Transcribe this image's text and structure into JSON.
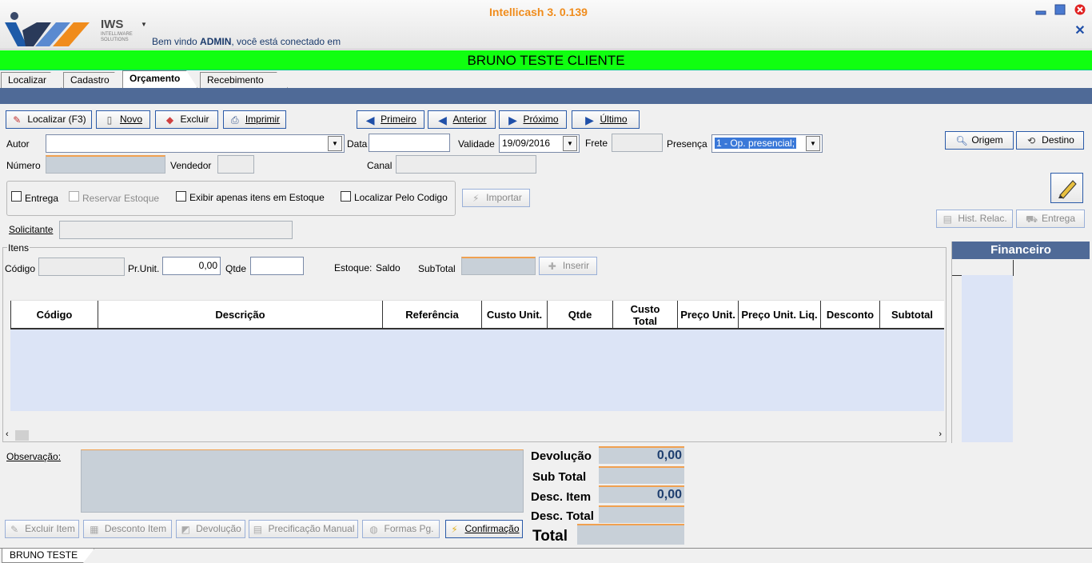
{
  "app": {
    "title": "Intellicash 3. 0.139",
    "brand": "IWS",
    "brand_sub": "INTELLIWARE SOLUTIONS",
    "welcome_prefix": "Bem vindo ",
    "welcome_user": "ADMIN",
    "welcome_suffix": ", você está conectado em"
  },
  "client_name": "BRUNO TESTE CLIENTE",
  "tabs": [
    {
      "label": "Localizar"
    },
    {
      "label": "Cadastro"
    },
    {
      "label": "Orçamento",
      "active": true
    },
    {
      "label": "Recebimento"
    }
  ],
  "toolbar": {
    "localizar": "Localizar (F3)",
    "novo": "Novo",
    "excluir": "Excluir",
    "imprimir": "Imprimir",
    "primeiro": "Primeiro",
    "anterior": "Anterior",
    "proximo": "Próximo",
    "ultimo": "Último",
    "origem": "Origem",
    "destino": "Destino",
    "hist_relac": "Hist. Relac.",
    "entrega": "Entrega"
  },
  "form": {
    "autor_label": "Autor",
    "autor_value": "",
    "data_label": "Data",
    "data_value": "",
    "validade_label": "Validade",
    "validade_value": "19/09/2016",
    "frete_label": "Frete",
    "frete_value": "",
    "presenca_label": "Presença",
    "presenca_value": "1 - Op. presencial;",
    "numero_label": "Número",
    "numero_value": "",
    "vendedor_label": "Vendedor",
    "vendedor_value": "",
    "canal_label": "Canal",
    "canal_value": "",
    "solicitante_label": "Solicitante",
    "solicitante_value": ""
  },
  "options": {
    "entrega": "Entrega",
    "reservar_estoque": "Reservar Estoque",
    "exibir_estoque": "Exibir apenas itens em Estoque",
    "localizar_codigo": "Localizar Pelo Codigo",
    "importar": "Importar"
  },
  "itens": {
    "group_label": "Itens",
    "codigo_label": "Código",
    "codigo_value": "",
    "prunit_label": "Pr.Unit.",
    "prunit_value": "0,00",
    "qtde_label": "Qtde",
    "qtde_value": "",
    "estoque_label": "Estoque:",
    "saldo_label": "Saldo",
    "subtotal_label": "SubTotal",
    "subtotal_value": "",
    "inserir": "Inserir"
  },
  "grid": {
    "columns": [
      "Código",
      "Descrição",
      "Referência",
      "Custo Unit.",
      "Qtde",
      "Custo Total",
      "Preço Unit.",
      "Preço Unit. Liq.",
      "Desconto",
      "Subtotal"
    ],
    "rows": []
  },
  "financeiro": {
    "title": "Financeiro"
  },
  "observacao_label": "Observação:",
  "observacao_value": "",
  "totals": {
    "devolucao_label": "Devolução",
    "devolucao_value": "0,00",
    "subtotal_label": "Sub Total",
    "subtotal_value": "",
    "desc_item_label": "Desc. Item",
    "desc_item_value": "0,00",
    "desc_total_label": "Desc. Total",
    "desc_total_value": "",
    "total_label": "Total",
    "total_value": ""
  },
  "bottom_buttons": {
    "excluir_item": "Excluir Item",
    "desconto_item": "Desconto Item",
    "devolucao": "Devolução",
    "precificacao": "Precificação Manual",
    "formas_pg": "Formas Pg.",
    "confirmacao": "Confirmação"
  },
  "status_tab": "BRUNO TESTE",
  "colors": {
    "client_bar": "#10ff10",
    "accent_blue": "#4f6a97",
    "title_orange": "#f08c1c",
    "grid_fill": "#dce4f6"
  }
}
